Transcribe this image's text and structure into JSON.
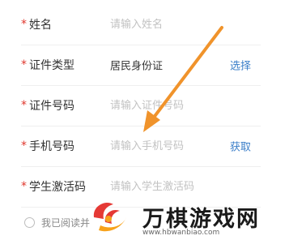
{
  "required_mark": "*",
  "form": {
    "name": {
      "label": "姓名",
      "placeholder": "请输入姓名"
    },
    "id_type": {
      "label": "证件类型",
      "value": "居民身份证",
      "action": "选择"
    },
    "id_number": {
      "label": "证件号码",
      "placeholder": "请输入证件号码"
    },
    "phone": {
      "label": "手机号码",
      "placeholder": "请输入手机号码",
      "action": "获取"
    },
    "activation_code": {
      "label": "学生激活码",
      "placeholder": "请输入学生激活码"
    }
  },
  "agreement": {
    "text": "我已阅读并"
  },
  "watermark": {
    "title": "万棋游戏网",
    "url": "www.hbwanbiao.com"
  },
  "colors": {
    "required": "#e0362c",
    "action_link": "#3a7ec8",
    "arrow": "#f0932b",
    "placeholder": "#c2c2c2",
    "divider": "#efefef"
  },
  "icons": [
    "pointer-arrow-icon",
    "watermark-logo-icon",
    "radio-circle-icon"
  ]
}
